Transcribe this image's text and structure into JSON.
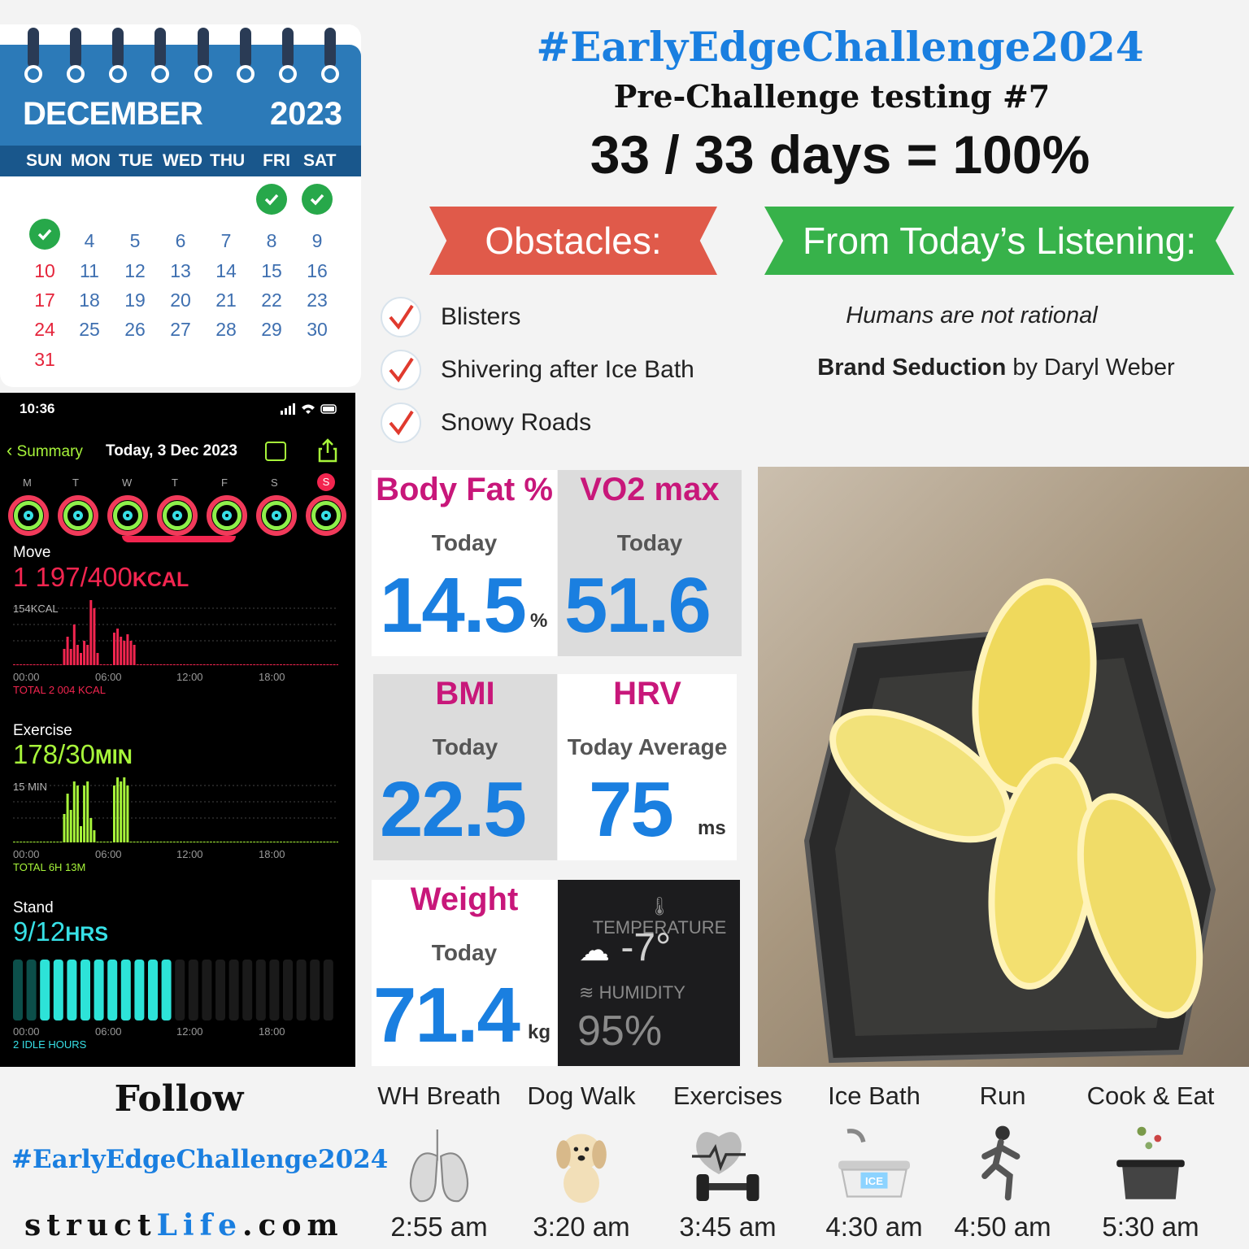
{
  "calendar": {
    "month": "DECEMBER",
    "year": "2023",
    "weekdays": [
      "SUN",
      "MON",
      "TUE",
      "WED",
      "THU",
      "FRI",
      "SAT"
    ],
    "weeks": [
      [
        "",
        "",
        "",
        "",
        "",
        "✓",
        "✓"
      ],
      [
        "✓",
        "4",
        "5",
        "6",
        "7",
        "8",
        "9"
      ],
      [
        "10",
        "11",
        "12",
        "13",
        "14",
        "15",
        "16"
      ],
      [
        "17",
        "18",
        "19",
        "20",
        "21",
        "22",
        "23"
      ],
      [
        "24",
        "25",
        "26",
        "27",
        "28",
        "29",
        "30"
      ],
      [
        "31",
        "",
        "",
        "",
        "",
        "",
        ""
      ]
    ],
    "colors": {
      "header": "#2c7ab8",
      "weekday_bar": "#19578c",
      "sunday": "#e5243b",
      "date": "#3e6fb0",
      "check": "#27a84a"
    }
  },
  "phone": {
    "time": "10:36",
    "back_label": "Summary",
    "date": "Today, 3 Dec 2023",
    "week_days": [
      "M",
      "T",
      "W",
      "T",
      "F",
      "S",
      "S"
    ],
    "move": {
      "label": "Move",
      "value": "1 197/400",
      "unit": "KCAL",
      "scale": "154KCAL",
      "total": "TOTAL 2 004 KCAL",
      "color": "#f2254f"
    },
    "exercise": {
      "label": "Exercise",
      "value": "178/30",
      "unit": "MIN",
      "scale": "15 MIN",
      "total": "TOTAL 6H 13M",
      "color": "#a7f53a"
    },
    "stand": {
      "label": "Stand",
      "value": "9/12",
      "unit": "HRS",
      "total": "2 IDLE HOURS",
      "color": "#37e0e6"
    },
    "axis": [
      "00:00",
      "06:00",
      "12:00",
      "18:00"
    ]
  },
  "header": {
    "hashtag": "#EarlyEdgeChallenge2024",
    "subtitle": "Pre-Challenge testing #7",
    "days": "33 / 33 days = 100%"
  },
  "obstacles": {
    "title": "Obstacles:",
    "items": [
      "Blisters",
      "Shivering after Ice Bath",
      "Snowy Roads"
    ]
  },
  "listening": {
    "title": "From Today’s Listening:",
    "quote": "Humans are not rational",
    "book": "Brand Seduction",
    "by": "by Daryl Weber"
  },
  "metrics": {
    "body_fat": {
      "title": "Body Fat %",
      "sub": "Today",
      "value": "14.5",
      "unit": "%"
    },
    "vo2": {
      "title": "VO2 max",
      "sub": "Today",
      "value": "51.6"
    },
    "bmi": {
      "title": "BMI",
      "sub": "Today",
      "value": "22.5"
    },
    "hrv": {
      "title": "HRV",
      "sub": "Today Average",
      "value": "75",
      "unit": "ms"
    },
    "weight": {
      "title": "Weight",
      "sub": "Today",
      "value": "71.4",
      "unit": "kg"
    },
    "weather": {
      "temp_label": "TEMPERATURE",
      "temp": "-7°",
      "hum_label": "HUMIDITY",
      "hum": "95%"
    }
  },
  "follow": {
    "title": "Follow",
    "hashtag": "#EarlyEdgeChallenge2024",
    "site_a": "struct",
    "site_b": "Life",
    "site_c": ".com"
  },
  "activities": [
    {
      "label": "WH Breath",
      "time": "2:55 am",
      "icon": "lungs-icon"
    },
    {
      "label": "Dog Walk",
      "time": "3:20 am",
      "icon": "puppy-icon"
    },
    {
      "label": "Exercises",
      "time": "3:45 am",
      "icon": "dumbbell-heart-icon"
    },
    {
      "label": "Ice Bath",
      "time": "4:30 am",
      "icon": "ice-bath-icon"
    },
    {
      "label": "Run",
      "time": "4:50 am",
      "icon": "runner-icon"
    },
    {
      "label": "Cook & Eat",
      "time": "5:30 am",
      "icon": "cooking-pot-icon"
    }
  ]
}
